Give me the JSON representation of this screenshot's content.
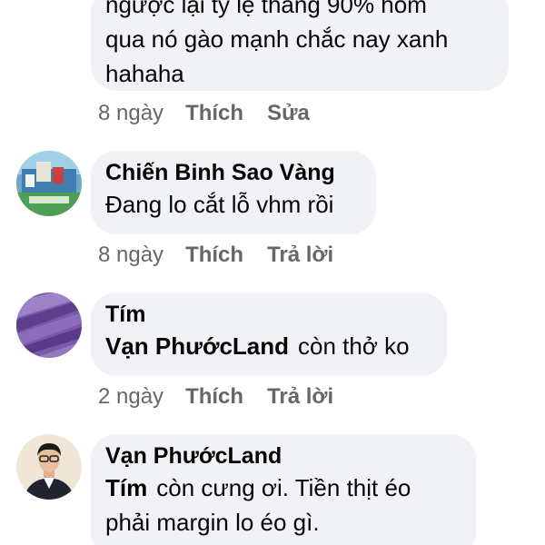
{
  "comments": [
    {
      "text_lines": [
        "ngược lại tỷ lệ thắng 90% hôm",
        "qua nó gào mạnh chắc nay xanh",
        "hahaha"
      ],
      "time": "8 ngày",
      "like_label": "Thích",
      "second_action": "Sửa"
    },
    {
      "author": "Chiến Binh Sao Vàng",
      "text": "Đang lo cắt lỗ vhm rồi",
      "time": "8 ngày",
      "like_label": "Thích",
      "reply_label": "Trả lời",
      "avatar_icon": "photo-avatar"
    },
    {
      "author": "Tím",
      "mention": "Vạn PhướcLand",
      "text": "còn thở ko",
      "time": "2 ngày",
      "like_label": "Thích",
      "reply_label": "Trả lời",
      "avatar_icon": "lavender-field-avatar"
    },
    {
      "author": "Vạn PhướcLand",
      "mention": "Tím",
      "text": "còn cưng ơi. Tiền thịt éo",
      "text_line2": "phải margin lo éo gì.",
      "avatar_icon": "person-photo-avatar"
    }
  ],
  "colors": {
    "bubble_bg": "#f0f2f5",
    "meta_text": "#65676b",
    "text": "#050505"
  }
}
